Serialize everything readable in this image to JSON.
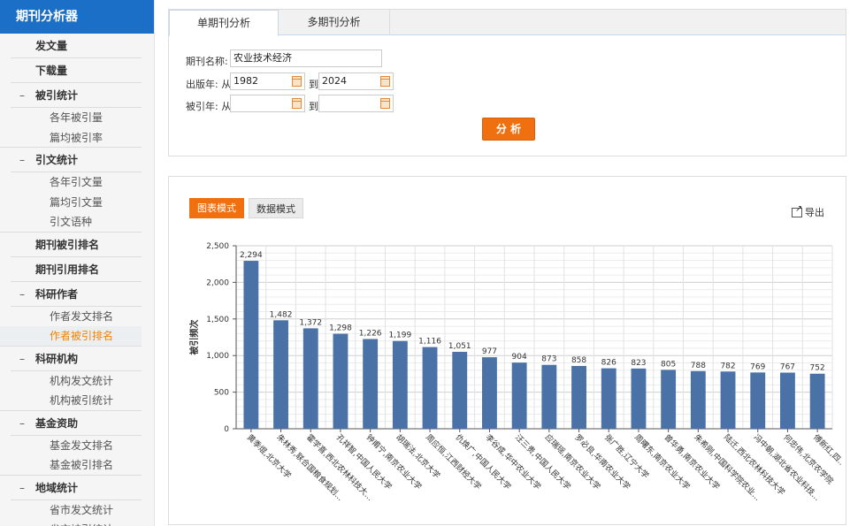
{
  "sidebar": {
    "title": "期刊分析器",
    "items": [
      {
        "type": "sec",
        "label": "发文量"
      },
      {
        "type": "sec",
        "label": "下载量"
      },
      {
        "type": "grp",
        "label": "被引统计"
      },
      {
        "type": "sub",
        "label": "各年被引量"
      },
      {
        "type": "sub",
        "label": "篇均被引率",
        "last": true
      },
      {
        "type": "grp",
        "label": "引文统计"
      },
      {
        "type": "sub",
        "label": "各年引文量"
      },
      {
        "type": "sub",
        "label": "篇均引文量"
      },
      {
        "type": "sub",
        "label": "引文语种",
        "last": true
      },
      {
        "type": "sec",
        "label": "期刊被引排名"
      },
      {
        "type": "sec",
        "label": "期刊引用排名"
      },
      {
        "type": "grp",
        "label": "科研作者"
      },
      {
        "type": "sub",
        "label": "作者发文排名"
      },
      {
        "type": "sub",
        "label": "作者被引排名",
        "selected": true,
        "last": true
      },
      {
        "type": "grp",
        "label": "科研机构"
      },
      {
        "type": "sub",
        "label": "机构发文统计"
      },
      {
        "type": "sub",
        "label": "机构被引统计",
        "last": true
      },
      {
        "type": "grp",
        "label": "基金资助"
      },
      {
        "type": "sub",
        "label": "基金发文排名"
      },
      {
        "type": "sub",
        "label": "基金被引排名",
        "last": true
      },
      {
        "type": "grp",
        "label": "地域统计"
      },
      {
        "type": "sub",
        "label": "省市发文统计"
      },
      {
        "type": "sub",
        "label": "省市被引统计"
      }
    ]
  },
  "tabs": {
    "active": "单期刊分析",
    "other": "多期刊分析"
  },
  "form": {
    "journal_label": "期刊名称:",
    "journal_value": "农业技术经济",
    "pub_year_label": "出版年: 从",
    "pub_from": "1982",
    "pub_to": "2024",
    "to_label": "到",
    "cite_year_label": "被引年: 从",
    "cite_from": "",
    "cite_to": "",
    "analyze_label": "分 析"
  },
  "view": {
    "chart_mode": "图表模式",
    "data_mode": "数据模式",
    "export_label": "导出"
  },
  "colors": {
    "accent": "#f07010",
    "header": "#1b6fc6",
    "bar": "#4a72a6"
  },
  "chart_data": {
    "type": "bar",
    "ylabel": "被引频次",
    "xlabel": "",
    "ylim": [
      0,
      2500
    ],
    "yticks": [
      0,
      500,
      1000,
      1500,
      2000,
      2500
    ],
    "grid": true,
    "categories": [
      "黄季焜,北京大学",
      "朱林秀,联合国粮食规划...",
      "霍学喜,西北农林科技大...",
      "孔祥智,中国人民大学",
      "钟甫宁,南京农业大学",
      "胡瑞法,北京大学",
      "周应恒,江西财经大学",
      "仇焕广,中国人民大学",
      "李谷成,华中农业大学",
      "汪三贵,中国人民大学",
      "应瑞瑶,南京农业大学",
      "罗必良,华南农业大学",
      "张广胜,辽宁大学",
      "周曙东,南京农业大学",
      "曾华勇,南京农业大学",
      "朱希刚,中国科学院农业...",
      "陆迁,西北农林科技大学",
      "冯中朝,湖北省农业科技...",
      "何忠伟,北京农学院",
      "傅新红,四..."
    ],
    "values": [
      2294,
      1482,
      1372,
      1298,
      1226,
      1199,
      1116,
      1051,
      977,
      904,
      873,
      858,
      826,
      823,
      805,
      788,
      782,
      769,
      767,
      752
    ],
    "value_labels": [
      "2,294",
      "1,482",
      "1,372",
      "1,298",
      "1,226",
      "1,199",
      "1,116",
      "1,051",
      "977",
      "904",
      "873",
      "858",
      "826",
      "823",
      "805",
      "788",
      "782",
      "769",
      "767",
      "752"
    ],
    "ytick_labels": [
      "0",
      "500",
      "1,000",
      "1,500",
      "2,000",
      "2,500"
    ]
  }
}
